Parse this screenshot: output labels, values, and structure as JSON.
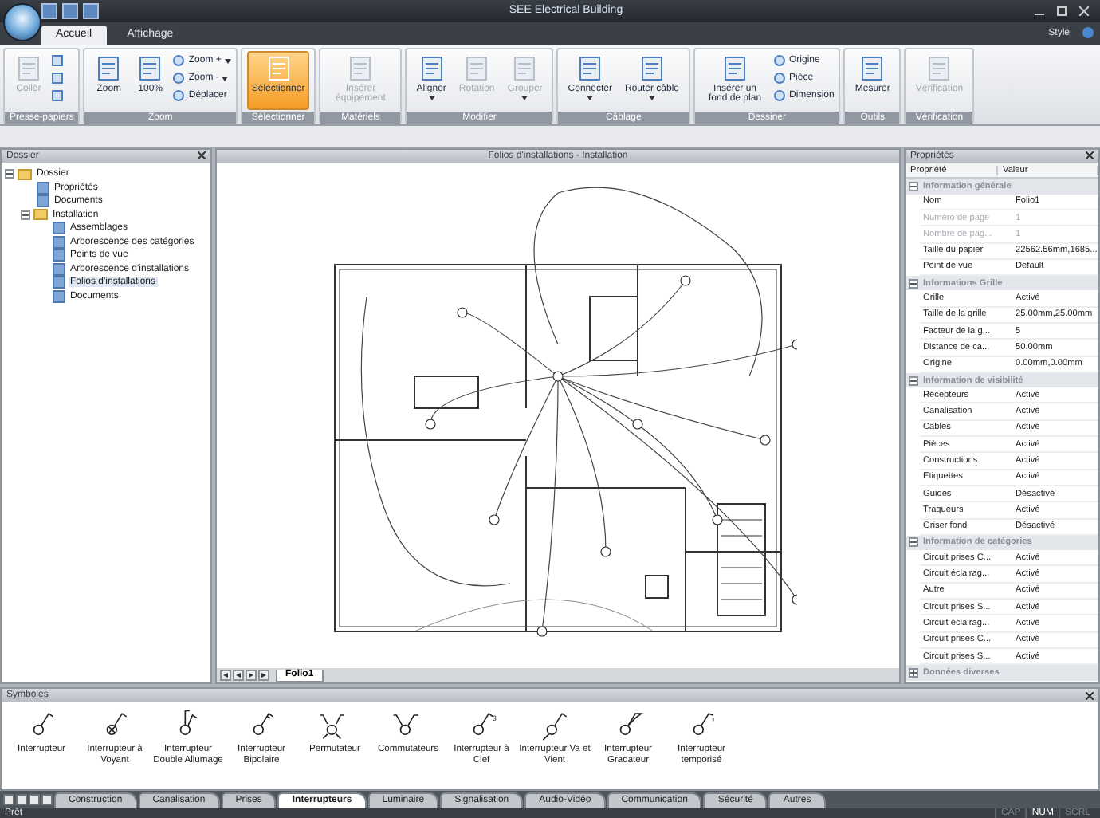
{
  "window": {
    "title": "SEE Electrical Building",
    "style_menu": "Style"
  },
  "ribbon_tabs": [
    {
      "label": "Accueil",
      "selected": true
    },
    {
      "label": "Affichage",
      "selected": false
    }
  ],
  "ribbon_groups": [
    {
      "label": "Presse-papiers",
      "items": [
        {
          "kind": "large",
          "label": "Coller",
          "disabled": true,
          "selected": false,
          "dropdown": false
        },
        {
          "kind": "icon"
        },
        {
          "kind": "icon"
        },
        {
          "kind": "icon"
        }
      ]
    },
    {
      "label": "Zoom",
      "items": [
        {
          "kind": "large",
          "label": "Zoom",
          "disabled": false,
          "selected": false,
          "dropdown": false
        },
        {
          "kind": "large",
          "label": "100%",
          "disabled": false,
          "selected": false,
          "dropdown": false
        },
        {
          "kind": "small",
          "label": "Zoom +",
          "dropdown": true
        },
        {
          "kind": "small",
          "label": "Zoom -",
          "dropdown": true
        },
        {
          "kind": "small",
          "label": "Déplacer",
          "dropdown": false
        }
      ]
    },
    {
      "label": "Sélectionner",
      "items": [
        {
          "kind": "large",
          "label": "Sélectionner",
          "disabled": false,
          "selected": true,
          "dropdown": false
        }
      ]
    },
    {
      "label": "Matériels",
      "items": [
        {
          "kind": "large",
          "label": "Insérer équipement",
          "disabled": true,
          "selected": false,
          "dropdown": false
        }
      ]
    },
    {
      "label": "Modifier",
      "items": [
        {
          "kind": "large",
          "label": "Aligner",
          "disabled": false,
          "selected": false,
          "dropdown": true
        },
        {
          "kind": "large",
          "label": "Rotation",
          "disabled": true,
          "selected": false,
          "dropdown": false
        },
        {
          "kind": "large",
          "label": "Grouper",
          "disabled": true,
          "selected": false,
          "dropdown": true
        }
      ]
    },
    {
      "label": "Câblage",
      "items": [
        {
          "kind": "large",
          "label": "Connecter",
          "disabled": false,
          "selected": false,
          "dropdown": true
        },
        {
          "kind": "large",
          "label": "Router câble",
          "disabled": false,
          "selected": false,
          "dropdown": true
        }
      ]
    },
    {
      "label": "Dessiner",
      "items": [
        {
          "kind": "large",
          "label": "Insérer un fond de plan",
          "disabled": false,
          "selected": false,
          "dropdown": false
        },
        {
          "kind": "small",
          "label": "Origine",
          "dropdown": false
        },
        {
          "kind": "small",
          "label": "Pièce",
          "dropdown": false
        },
        {
          "kind": "small",
          "label": "Dimension",
          "dropdown": false
        }
      ]
    },
    {
      "label": "Outils",
      "items": [
        {
          "kind": "large",
          "label": "Mesurer",
          "disabled": false,
          "selected": false,
          "dropdown": false
        }
      ]
    },
    {
      "label": "Vérification",
      "items": [
        {
          "kind": "large",
          "label": "Vérification",
          "disabled": true,
          "selected": false,
          "dropdown": false
        }
      ]
    }
  ],
  "folder_panel": {
    "title": "Dossier",
    "tree": [
      {
        "label": "Dossier",
        "expanded": true,
        "selected": false,
        "children": [
          {
            "label": "Propriétés",
            "selected": false
          },
          {
            "label": "Documents",
            "selected": false
          },
          {
            "label": "Installation",
            "expanded": true,
            "selected": false,
            "children": [
              {
                "label": "Assemblages",
                "selected": false
              },
              {
                "label": "Arborescence des catégories",
                "selected": false
              },
              {
                "label": "Points de vue",
                "selected": false
              },
              {
                "label": "Arborescence d'installations",
                "selected": false
              },
              {
                "label": "Folios d'installations",
                "selected": true
              },
              {
                "label": "Documents",
                "selected": false
              }
            ]
          }
        ]
      }
    ]
  },
  "drawing": {
    "title": "Folios d'installations - Installation",
    "sheet_tabs": [
      {
        "label": "Folio1",
        "selected": true
      }
    ]
  },
  "properties": {
    "title": "Propriétés",
    "columns": [
      "Propriété",
      "Valeur"
    ],
    "sections": [
      {
        "title": "Information générale",
        "expanded": true,
        "rows": [
          {
            "name": "Nom",
            "value": "Folio1",
            "disabled": false
          },
          {
            "name": "Numéro de page",
            "value": "1",
            "disabled": true
          },
          {
            "name": "Nombre de pag...",
            "value": "1",
            "disabled": true
          },
          {
            "name": "Taille du papier",
            "value": "22562.56mm,1685...",
            "disabled": false
          },
          {
            "name": "Point de vue",
            "value": "Default",
            "disabled": false
          }
        ]
      },
      {
        "title": "Informations Grille",
        "expanded": true,
        "rows": [
          {
            "name": "Grille",
            "value": "Activé",
            "disabled": false
          },
          {
            "name": "Taille de la grille",
            "value": "25.00mm,25.00mm",
            "disabled": false
          },
          {
            "name": "Facteur de la g...",
            "value": "5",
            "disabled": false
          },
          {
            "name": "Distance de ca...",
            "value": "50.00mm",
            "disabled": false
          },
          {
            "name": "Origine",
            "value": "0.00mm,0.00mm",
            "disabled": false
          }
        ]
      },
      {
        "title": "Information de visibilité",
        "expanded": true,
        "rows": [
          {
            "name": "Récepteurs",
            "value": "Activé",
            "disabled": false
          },
          {
            "name": "Canalisation",
            "value": "Activé",
            "disabled": false
          },
          {
            "name": "Câbles",
            "value": "Activé",
            "disabled": false
          },
          {
            "name": "Pièces",
            "value": "Activé",
            "disabled": false
          },
          {
            "name": "Constructions",
            "value": "Activé",
            "disabled": false
          },
          {
            "name": "Etiquettes",
            "value": "Activé",
            "disabled": false
          },
          {
            "name": "Guides",
            "value": "Désactivé",
            "disabled": false
          },
          {
            "name": "Traqueurs",
            "value": "Activé",
            "disabled": false
          },
          {
            "name": "Griser fond",
            "value": "Désactivé",
            "disabled": false
          }
        ]
      },
      {
        "title": "Information de catégories",
        "expanded": true,
        "rows": [
          {
            "name": "Circuit prises C...",
            "value": "Activé",
            "disabled": false
          },
          {
            "name": "Circuit éclairag...",
            "value": "Activé",
            "disabled": false
          },
          {
            "name": "Autre",
            "value": "Activé",
            "disabled": false
          },
          {
            "name": "Circuit prises S...",
            "value": "Activé",
            "disabled": false
          },
          {
            "name": "Circuit éclairag...",
            "value": "Activé",
            "disabled": false
          },
          {
            "name": "Circuit prises C...",
            "value": "Activé",
            "disabled": false
          },
          {
            "name": "Circuit prises S...",
            "value": "Activé",
            "disabled": false
          }
        ]
      },
      {
        "title": "Données diverses",
        "expanded": false
      }
    ]
  },
  "symbols_panel": {
    "title": "Symboles",
    "symbols": [
      {
        "label": "Interrupteur",
        "kind": "simple"
      },
      {
        "label": "Interrupteur à Voyant",
        "kind": "voyant"
      },
      {
        "label": "Interrupteur Double Allumage",
        "kind": "double"
      },
      {
        "label": "Interrupteur Bipolaire",
        "kind": "bipolaire"
      },
      {
        "label": "Permutateur",
        "kind": "permutateur"
      },
      {
        "label": "Commutateurs",
        "kind": "commutateur"
      },
      {
        "label": "Interrupteur à Clef",
        "kind": "clef",
        "badge": "3"
      },
      {
        "label": "Interrupteur Va et Vient",
        "kind": "vaetvient"
      },
      {
        "label": "Interrupteur Gradateur",
        "kind": "gradateur"
      },
      {
        "label": "Interrupteur temporisé",
        "kind": "temporise"
      }
    ],
    "category_tabs": [
      {
        "label": "Construction",
        "selected": false
      },
      {
        "label": "Canalisation",
        "selected": false
      },
      {
        "label": "Prises",
        "selected": false
      },
      {
        "label": "Interrupteurs",
        "selected": true
      },
      {
        "label": "Luminaire",
        "selected": false
      },
      {
        "label": "Signalisation",
        "selected": false
      },
      {
        "label": "Audio-Vidéo",
        "selected": false
      },
      {
        "label": "Communication",
        "selected": false
      },
      {
        "label": "Sécurité",
        "selected": false
      },
      {
        "label": "Autres",
        "selected": false
      }
    ]
  },
  "status_bar": {
    "text": "Prêt",
    "indicators": [
      {
        "label": "CAP",
        "on": false
      },
      {
        "label": "NUM",
        "on": true
      },
      {
        "label": "SCRL",
        "on": false
      }
    ]
  }
}
